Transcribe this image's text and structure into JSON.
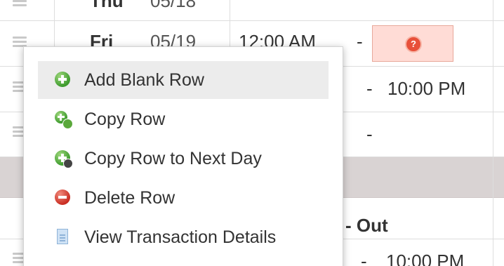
{
  "grid": {
    "rows": [
      {
        "day": "Thu",
        "date": "05/18",
        "start": "",
        "sep": "",
        "end": ""
      },
      {
        "day": "Fri",
        "date": "05/19",
        "start": "12:00 AM",
        "sep": "-",
        "end": ""
      },
      {
        "day": "",
        "date": "",
        "start": "",
        "sep": "-",
        "end": "10:00 PM"
      },
      {
        "day": "",
        "date": "",
        "start": "",
        "sep": "-",
        "end": ""
      },
      {
        "section_header": ""
      },
      {
        "day": "",
        "date": "",
        "start": "",
        "sep": "- Out",
        "end": ""
      },
      {
        "day": "",
        "date": "",
        "start": "",
        "sep": "-",
        "end": "10:00 PM"
      }
    ],
    "error_icon_glyph": "?"
  },
  "context_menu": {
    "items": [
      {
        "label": "Add Blank Row",
        "icon": "add-green-icon"
      },
      {
        "label": "Copy Row",
        "icon": "copy-green-icon"
      },
      {
        "label": "Copy Row to Next Day",
        "icon": "copy-next-day-icon"
      },
      {
        "label": "Delete Row",
        "icon": "delete-red-icon"
      },
      {
        "label": "View Transaction Details",
        "icon": "document-icon"
      }
    ],
    "hovered_index": 0
  },
  "colors": {
    "hover": "#ececec",
    "error_bg": "#ffdcd6",
    "shaded_row": "#d9d3d3"
  }
}
